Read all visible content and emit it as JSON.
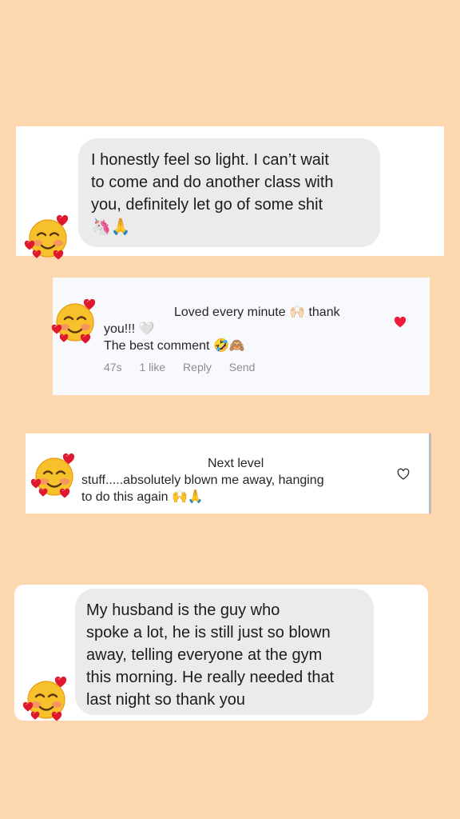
{
  "background_color": "#FDD8AE",
  "card1": {
    "message": "I honestly feel so light.  I can’t wait\nto come and do another class with\nyou, definitely let go of some shit",
    "emojis": "🦄🙏",
    "avatar_icon": "smiling-face-with-hearts-icon"
  },
  "card2": {
    "comment_line1": "Loved every minute 🙌🏻 thank",
    "comment_line2": "you!!! 🤍",
    "comment_line3": "The best comment 🤣🙈",
    "time": "47s",
    "likes": "1 like",
    "reply": "Reply",
    "send": "Send",
    "like_icon": "heart-filled-icon",
    "like_color": "#ed1c38"
  },
  "card3": {
    "comment_line1": "Next level",
    "comment_line2": "stuff.....absolutely blown me away, hanging",
    "comment_line3": "to do this again 🙌🙏",
    "like_icon": "heart-outline-icon"
  },
  "card4": {
    "message": "My husband is          the guy who\nspoke a lot, he is still just so blown\naway, telling everyone at the gym\nthis morning. He really needed that\nlast night so thank you",
    "avatar_icon": "smiling-face-with-hearts-icon"
  }
}
